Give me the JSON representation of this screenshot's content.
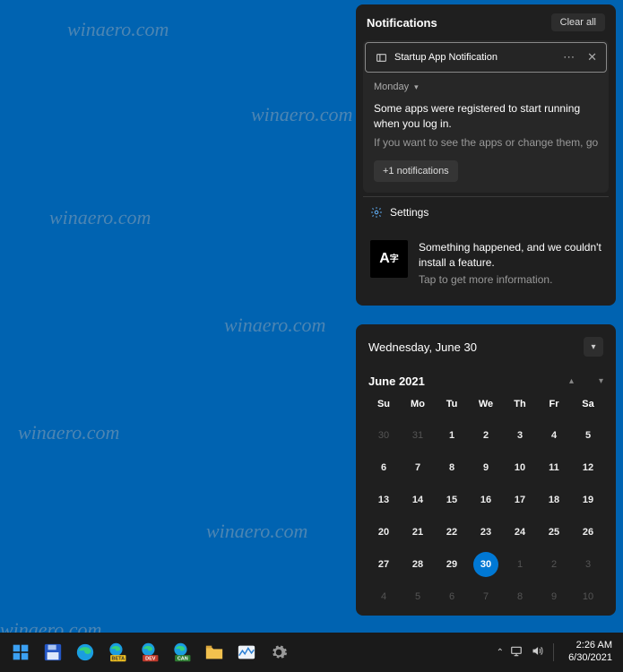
{
  "notifications": {
    "header_title": "Notifications",
    "clear_all_label": "Clear all",
    "card1": {
      "app_title": "Startup App Notification",
      "day_label": "Monday",
      "line1": "Some apps were registered to start running when you log in.",
      "line2": "If you want to see the apps or change them, go to S",
      "more_label": "+1 notifications"
    },
    "settings_label": "Settings",
    "card2": {
      "title": "Something happened, and we couldn't install a feature.",
      "sub": "Tap to get more information."
    }
  },
  "calendar": {
    "full_date": "Wednesday, June 30",
    "month_label": "June 2021",
    "dow": [
      "Su",
      "Mo",
      "Tu",
      "We",
      "Th",
      "Fr",
      "Sa"
    ],
    "weeks": [
      [
        {
          "n": "30",
          "dim": true
        },
        {
          "n": "31",
          "dim": true
        },
        {
          "n": "1"
        },
        {
          "n": "2"
        },
        {
          "n": "3"
        },
        {
          "n": "4"
        },
        {
          "n": "5"
        }
      ],
      [
        {
          "n": "6"
        },
        {
          "n": "7"
        },
        {
          "n": "8"
        },
        {
          "n": "9"
        },
        {
          "n": "10"
        },
        {
          "n": "11"
        },
        {
          "n": "12"
        }
      ],
      [
        {
          "n": "13"
        },
        {
          "n": "14"
        },
        {
          "n": "15"
        },
        {
          "n": "16"
        },
        {
          "n": "17"
        },
        {
          "n": "18"
        },
        {
          "n": "19"
        }
      ],
      [
        {
          "n": "20"
        },
        {
          "n": "21"
        },
        {
          "n": "22"
        },
        {
          "n": "23"
        },
        {
          "n": "24"
        },
        {
          "n": "25"
        },
        {
          "n": "26"
        }
      ],
      [
        {
          "n": "27"
        },
        {
          "n": "28"
        },
        {
          "n": "29"
        },
        {
          "n": "30",
          "today": true
        },
        {
          "n": "1",
          "dim": true
        },
        {
          "n": "2",
          "dim": true
        },
        {
          "n": "3",
          "dim": true
        }
      ],
      [
        {
          "n": "4",
          "dim": true
        },
        {
          "n": "5",
          "dim": true
        },
        {
          "n": "6",
          "dim": true
        },
        {
          "n": "7",
          "dim": true
        },
        {
          "n": "8",
          "dim": true
        },
        {
          "n": "9",
          "dim": true
        },
        {
          "n": "10",
          "dim": true
        }
      ]
    ]
  },
  "taskbar": {
    "time": "2:26 AM",
    "date": "6/30/2021"
  },
  "watermark": "winaero.com"
}
